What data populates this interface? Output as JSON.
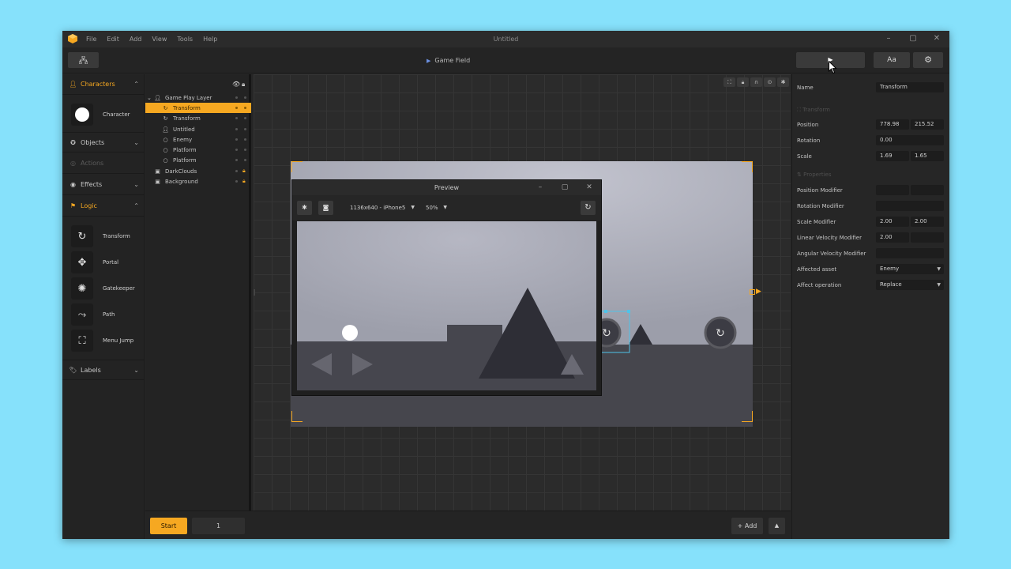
{
  "app": {
    "title": "Untitled",
    "menu": [
      "File",
      "Edit",
      "Add",
      "View",
      "Tools",
      "Help"
    ],
    "accent": "#f6a821"
  },
  "toolbar": {
    "breadcrumb": "Game Field",
    "text_button": "Aa",
    "icons": [
      "hierarchy-icon",
      "play-icon",
      "gear-icon"
    ]
  },
  "categories": {
    "characters": "Characters",
    "character_item": "Character",
    "objects": "Objects",
    "actions": "Actions",
    "effects": "Effects",
    "logic": "Logic",
    "logic_items": [
      "Transform",
      "Portal",
      "Gatekeeper",
      "Path",
      "Menu Jump"
    ],
    "labels": "Labels"
  },
  "layers": {
    "rows": [
      {
        "name": "Game Play Layer",
        "icon": "person-icon"
      },
      {
        "name": "Transform",
        "icon": "rotate-icon",
        "selected": true
      },
      {
        "name": "Transform",
        "icon": "rotate-icon"
      },
      {
        "name": "Untitled",
        "icon": "person-icon"
      },
      {
        "name": "Enemy",
        "icon": "circle-icon"
      },
      {
        "name": "Platform",
        "icon": "circle-icon"
      },
      {
        "name": "Platform",
        "icon": "circle-icon"
      },
      {
        "name": "DarkClouds",
        "icon": "image-icon",
        "locked": true
      },
      {
        "name": "Background",
        "icon": "image-icon",
        "locked": true
      }
    ]
  },
  "preview": {
    "title": "Preview",
    "device": "1136x640 - iPhone5",
    "zoom": "50%"
  },
  "bottom": {
    "start": "Start",
    "page": "1",
    "add": "+ Add"
  },
  "properties": {
    "name_label": "Name",
    "name_value": "Transform",
    "transform_section": "Transform",
    "position_label": "Position",
    "position_x": "778.98",
    "position_y": "215.52",
    "rotation_label": "Rotation",
    "rotation_value": "0.00",
    "scale_label": "Scale",
    "scale_x": "1.69",
    "scale_y": "1.65",
    "properties_section": "Properties",
    "position_modifier": "Position Modifier",
    "rotation_modifier": "Rotation Modifier",
    "scale_modifier": "Scale Modifier",
    "scale_modifier_x": "2.00",
    "scale_modifier_y": "2.00",
    "linear_velocity_modifier": "Linear Velocity Modifier",
    "linear_velocity_x": "2.00",
    "angular_velocity_modifier": "Angular Velocity Modifier",
    "affected_asset_label": "Affected asset",
    "affected_asset_value": "Enemy",
    "affect_operation_label": "Affect operation",
    "affect_operation_value": "Replace"
  }
}
